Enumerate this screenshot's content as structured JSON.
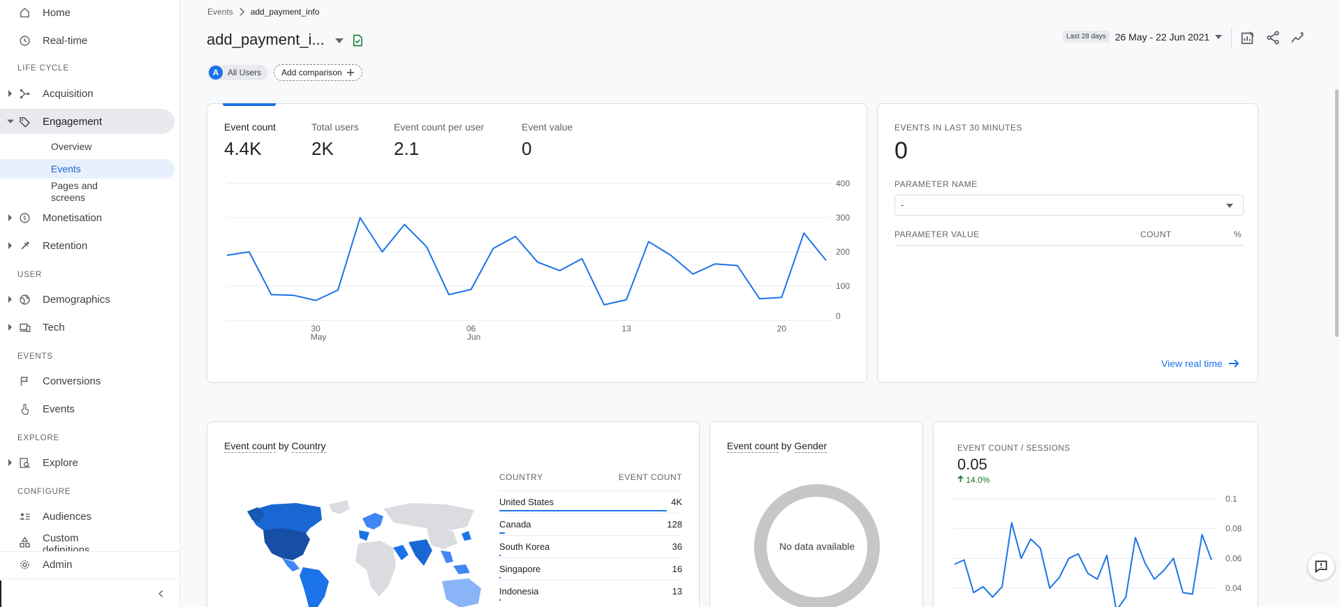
{
  "sidebar": {
    "home": "Home",
    "realtime": "Real-time",
    "sections": {
      "lifecycle": "LIFE CYCLE",
      "user": "USER",
      "events": "EVENTS",
      "explore": "EXPLORE",
      "configure": "CONFIGURE"
    },
    "acquisition": "Acquisition",
    "engagement": "Engagement",
    "engagement_sub": {
      "overview": "Overview",
      "events": "Events",
      "pages_line1": "Pages and",
      "pages_line2": "screens"
    },
    "monetisation": "Monetisation",
    "retention": "Retention",
    "demographics": "Demographics",
    "tech": "Tech",
    "conversions": "Conversions",
    "events": "Events",
    "explore": "Explore",
    "audiences": "Audiences",
    "custom_line1": "Custom",
    "custom_line2": "definitions",
    "admin": "Admin"
  },
  "header": {
    "breadcrumb_parent": "Events",
    "breadcrumb_current": "add_payment_info",
    "title": "add_payment_i...",
    "all_users_badge": "A",
    "all_users": "All Users",
    "add_comparison": "Add comparison",
    "date_label": "Last 28 days",
    "date_range": "26 May - 22 Jun 2021"
  },
  "metrics": [
    {
      "label": "Event count",
      "value": "4.4K"
    },
    {
      "label": "Total users",
      "value": "2K"
    },
    {
      "label": "Event count per user",
      "value": "2.1"
    },
    {
      "label": "Event value",
      "value": "0"
    }
  ],
  "realtime": {
    "title": "EVENTS IN LAST 30 MINUTES",
    "value": "0",
    "param_name": "PARAMETER NAME",
    "param_selected": "-",
    "col_value": "PARAMETER VALUE",
    "col_count": "COUNT",
    "col_pct": "%",
    "link": "View real time"
  },
  "country_card": {
    "title_a": "Event count",
    "title_by": "by",
    "title_b": "Country",
    "col_country": "COUNTRY",
    "col_count": "EVENT COUNT",
    "rows": [
      {
        "country": "United States",
        "count": "4K",
        "share": 1.0
      },
      {
        "country": "Canada",
        "count": "128",
        "share": 0.032
      },
      {
        "country": "South Korea",
        "count": "36",
        "share": 0.009
      },
      {
        "country": "Singapore",
        "count": "16",
        "share": 0.004
      },
      {
        "country": "Indonesia",
        "count": "13",
        "share": 0.003
      }
    ]
  },
  "gender_card": {
    "title_a": "Event count",
    "title_by": "by",
    "title_b": "Gender",
    "empty": "No data available"
  },
  "sessions_card": {
    "title": "EVENT COUNT / SESSIONS",
    "value": "0.05",
    "delta": "14.0%"
  },
  "chart_data": [
    {
      "type": "line",
      "x_tick_labels": [
        {
          "day": "30",
          "month": "May"
        },
        {
          "day": "06",
          "month": "Jun"
        },
        {
          "day": "13",
          "month": ""
        },
        {
          "day": "20",
          "month": ""
        }
      ],
      "x_tick_indices": [
        4,
        11,
        18,
        25
      ],
      "y_ticks": [
        0,
        100,
        200,
        300,
        400
      ],
      "ylim": [
        0,
        400
      ],
      "series": [
        {
          "values": [
            190,
            200,
            75,
            73,
            58,
            88,
            300,
            200,
            280,
            215,
            75,
            90,
            210,
            245,
            170,
            145,
            180,
            45,
            60,
            230,
            190,
            135,
            165,
            160,
            63,
            67,
            255,
            175
          ]
        }
      ],
      "grid": true,
      "color": "#1a73e8"
    },
    {
      "type": "line",
      "y_ticks": [
        0.04,
        0.06,
        0.08,
        0.1
      ],
      "ylim": [
        0.025,
        0.1
      ],
      "series": [
        {
          "values": [
            0.056,
            0.059,
            0.037,
            0.041,
            0.034,
            0.041,
            0.084,
            0.06,
            0.073,
            0.067,
            0.04,
            0.047,
            0.06,
            0.063,
            0.05,
            0.046,
            0.062,
            0.025,
            0.034,
            0.074,
            0.057,
            0.046,
            0.052,
            0.06,
            0.037,
            0.036,
            0.076,
            0.059
          ]
        }
      ],
      "grid": true,
      "color": "#1a73e8"
    }
  ],
  "colors": {
    "accent": "#1a73e8",
    "positive": "#137333"
  },
  "icons": [
    "home-icon",
    "clock-icon",
    "acquisition-icon",
    "tag-icon",
    "dollar-icon",
    "retention-icon",
    "globe-icon",
    "devices-icon",
    "flag-icon",
    "touch-icon",
    "explore-icon",
    "audiences-icon",
    "custom-definitions-icon",
    "gear-icon",
    "collapse-icon",
    "verified-icon",
    "plus-icon",
    "customize-report-icon",
    "share-icon",
    "insights-icon",
    "arrow-right-icon",
    "feedback-icon"
  ]
}
